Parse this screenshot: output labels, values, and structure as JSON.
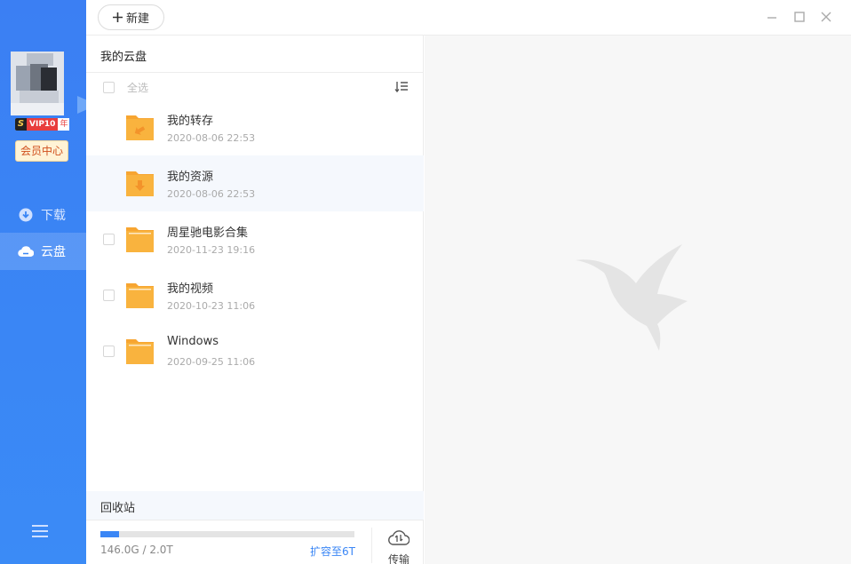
{
  "sidebar": {
    "vip_badge": {
      "s": "S",
      "text": "VIP10",
      "year": "年"
    },
    "member_center": "会员中心",
    "items": [
      {
        "label": "下载",
        "icon": "download-icon",
        "active": false
      },
      {
        "label": "云盘",
        "icon": "cloud-icon",
        "active": true
      }
    ]
  },
  "toolbar": {
    "new_label": "新建"
  },
  "panel": {
    "title": "我的云盘",
    "select_all": "全选",
    "files": [
      {
        "name": "我的转存",
        "date": "2020-08-06 22:53",
        "kind": "transfer-folder"
      },
      {
        "name": "我的资源",
        "date": "2020-08-06 22:53",
        "kind": "resource-folder"
      },
      {
        "name": "周星驰电影合集",
        "date": "2020-11-23 19:16",
        "kind": "folder"
      },
      {
        "name": "我的视频",
        "date": "2020-10-23 11:06",
        "kind": "folder"
      },
      {
        "name": "Windows",
        "date": "2020-09-25 11:06",
        "kind": "folder"
      }
    ],
    "recycle_bin": "回收站",
    "storage": {
      "used_text": "146.0G / 2.0T",
      "expand_text": "扩容至6T",
      "used_fraction": 0.073
    },
    "transfer_label": "传输"
  },
  "colors": {
    "accent": "#3a86f5",
    "folder": "#f9b33e",
    "folder_tab": "#f7a531"
  }
}
